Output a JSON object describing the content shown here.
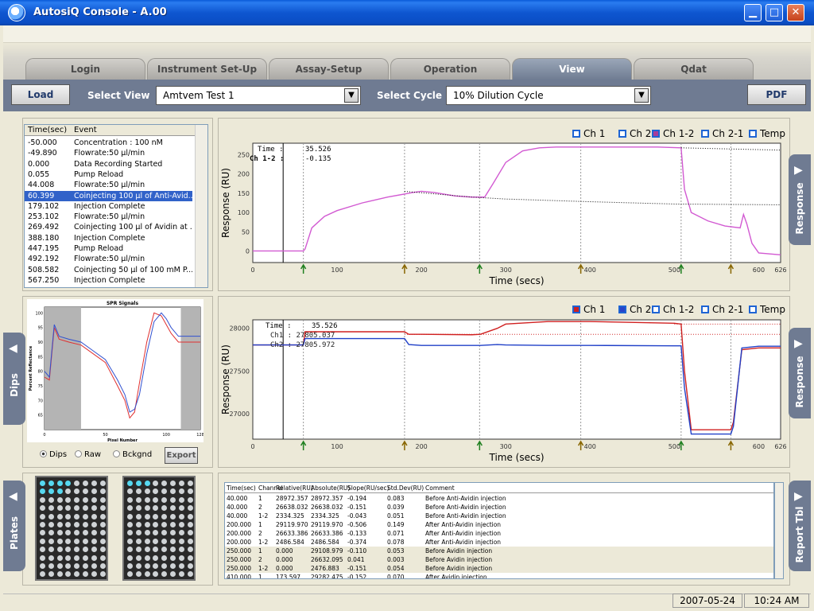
{
  "window": {
    "title": "AutosiQ Console - A.00"
  },
  "tabs": [
    {
      "label": "Login"
    },
    {
      "label": "Instrument Set-Up"
    },
    {
      "label": "Assay-Setup"
    },
    {
      "label": "Operation"
    },
    {
      "label": "View",
      "active": true
    },
    {
      "label": "Qdat"
    }
  ],
  "toolbar": {
    "load_label": "Load",
    "select_view_label": "Select  View",
    "select_view_value": "Amtvem Test 1",
    "select_cycle_label": "Select  Cycle",
    "select_cycle_value": "10% Dilution Cycle",
    "pdf_label": "PDF"
  },
  "events": {
    "headers": [
      "Time(sec)",
      "Event"
    ],
    "rows": [
      [
        "-50.000",
        "Concentration : 100 nM"
      ],
      [
        "-49.890",
        "Flowrate:50 µl/min"
      ],
      [
        "0.000",
        "Data Recording Started"
      ],
      [
        "0.055",
        "Pump Reload"
      ],
      [
        "44.008",
        "Flowrate:50 µl/min"
      ],
      [
        "60.399",
        "Coinjecting 100 µl of Anti-Avid..."
      ],
      [
        "179.102",
        "Injection Complete"
      ],
      [
        "253.102",
        "Flowrate:50 µl/min"
      ],
      [
        "269.492",
        "Coinjecting 100 µl of Avidin at ..."
      ],
      [
        "388.180",
        "Injection Complete"
      ],
      [
        "447.195",
        "Pump Reload"
      ],
      [
        "492.192",
        "Flowrate:50 µl/min"
      ],
      [
        "508.582",
        "Coinjecting 50 µl of 100 mM P..."
      ],
      [
        "567.250",
        "Injection Complete"
      ]
    ],
    "selected_index": 5
  },
  "top_chart": {
    "legend": [
      "Ch 1",
      "Ch 2",
      "Ch 1-2",
      "Ch 2-1",
      "Temp"
    ],
    "cursor_time_label": "Time :",
    "cursor_time_value": "35.526",
    "cursor_ch_label": "Ch 1-2 :",
    "cursor_ch_value": "-0.135",
    "ylabel": "Response (RU)",
    "xlabel": "Time (secs)"
  },
  "bottom_chart": {
    "legend": [
      "Ch 1",
      "Ch 2",
      "Ch 1-2",
      "Ch 2-1",
      "Temp"
    ],
    "cursor_time_label": "Time :",
    "cursor_time_value": "35.526",
    "cursor_ch1": "Ch1 : 27805.037",
    "cursor_ch2": "Ch2 : 27805.972",
    "ylabel": "Response (RU)",
    "xlabel": "Time (secs)"
  },
  "chart_data": [
    {
      "type": "line",
      "title": "",
      "xlabel": "Time (secs)",
      "ylabel": "Response (RU)",
      "xlim": [
        0,
        626
      ],
      "ylim": [
        -30,
        280
      ],
      "xticks": [
        0,
        100,
        200,
        300,
        400,
        500,
        600,
        626
      ],
      "yticks": [
        0,
        50,
        100,
        150,
        200,
        250
      ],
      "series": [
        {
          "name": "Ch 1-2",
          "color": "#d25ad2",
          "x": [
            0,
            60,
            62,
            70,
            85,
            100,
            130,
            160,
            190,
            200,
            215,
            240,
            260,
            275,
            285,
            300,
            320,
            340,
            360,
            400,
            440,
            480,
            508,
            512,
            520,
            540,
            560,
            578,
            582,
            586,
            592,
            600,
            626
          ],
          "y": [
            0,
            0,
            5,
            60,
            90,
            105,
            125,
            140,
            152,
            155,
            152,
            143,
            140,
            140,
            175,
            230,
            260,
            268,
            270,
            270,
            270,
            270,
            268,
            160,
            100,
            78,
            65,
            60,
            95,
            70,
            20,
            -5,
            -10
          ]
        },
        {
          "name": "reference-dotted",
          "color": "#000000",
          "dotted": true,
          "x": [
            180,
            260,
            300,
            400,
            500,
            626
          ],
          "y": [
            155,
            140,
            135,
            128,
            122,
            120
          ]
        },
        {
          "name": "reference-dotted-upper",
          "color": "#000000",
          "dotted": true,
          "x": [
            508,
            626
          ],
          "y": [
            268,
            262
          ]
        }
      ],
      "injection_markers": [
        60,
        180,
        269,
        389,
        508,
        567
      ]
    },
    {
      "type": "line",
      "title": "",
      "xlabel": "Time (secs)",
      "ylabel": "Response (RU)",
      "xlim": [
        0,
        626
      ],
      "ylim": [
        26700,
        28100
      ],
      "xticks": [
        0,
        100,
        200,
        300,
        400,
        500,
        600,
        626
      ],
      "yticks": [
        27000,
        27500,
        28000
      ],
      "series": [
        {
          "name": "Ch 1",
          "color": "#d02020",
          "x": [
            0,
            60,
            62,
            180,
            185,
            200,
            260,
            270,
            290,
            300,
            350,
            400,
            500,
            508,
            512,
            520,
            567,
            570,
            580,
            600,
            626
          ],
          "y": [
            27805,
            27805,
            27960,
            27960,
            27930,
            27930,
            27925,
            27930,
            28000,
            28050,
            28080,
            28080,
            28060,
            28050,
            27500,
            26810,
            26810,
            26900,
            27750,
            27770,
            27770
          ]
        },
        {
          "name": "Ch 2",
          "color": "#2040c8",
          "x": [
            0,
            60,
            62,
            180,
            185,
            200,
            260,
            270,
            290,
            300,
            350,
            400,
            500,
            508,
            512,
            520,
            567,
            570,
            580,
            600,
            626
          ],
          "y": [
            27805,
            27805,
            27880,
            27880,
            27810,
            27800,
            27800,
            27800,
            27810,
            27805,
            27800,
            27800,
            27795,
            27795,
            27300,
            26760,
            26760,
            26850,
            27770,
            27790,
            27790
          ]
        },
        {
          "name": "Ch1-ref",
          "color": "#d02020",
          "dotted": true,
          "x": [
            500,
            626
          ],
          "y": [
            28050,
            28050
          ]
        },
        {
          "name": "Ch1-ref2",
          "color": "#d02020",
          "dotted": true,
          "x": [
            180,
            626
          ],
          "y": [
            27930,
            27930
          ]
        }
      ],
      "injection_markers": [
        60,
        180,
        269,
        389,
        508,
        567
      ]
    },
    {
      "type": "line",
      "title": "SPR Signals",
      "xlabel": "Pixel Number",
      "ylabel": "Percent Reflectance",
      "xlim": [
        0,
        128
      ],
      "ylim": [
        60,
        102
      ],
      "xticks": [
        0,
        50,
        100,
        128
      ],
      "yticks": [
        65,
        70,
        75,
        80,
        85,
        90,
        95,
        100
      ],
      "series": [
        {
          "name": "red",
          "color": "#e03030",
          "x": [
            0,
            4,
            8,
            12,
            20,
            30,
            40,
            50,
            60,
            66,
            70,
            74,
            78,
            84,
            90,
            96,
            100,
            104,
            110,
            116,
            120,
            128
          ],
          "y": [
            78,
            77,
            95,
            91,
            90,
            89,
            86,
            83,
            75,
            70,
            64,
            66,
            76,
            90,
            100,
            99,
            96,
            93,
            90,
            90,
            90,
            90
          ]
        },
        {
          "name": "blue",
          "color": "#3050d0",
          "x": [
            0,
            4,
            8,
            12,
            20,
            30,
            40,
            50,
            60,
            66,
            70,
            74,
            78,
            84,
            90,
            96,
            100,
            104,
            110,
            116,
            120,
            128
          ],
          "y": [
            80,
            78,
            96,
            92,
            91,
            90,
            87,
            84,
            77,
            72,
            66,
            67,
            72,
            86,
            97,
            100,
            98,
            95,
            92,
            92,
            92,
            92
          ]
        }
      ]
    }
  ],
  "dips_panel": {
    "options": [
      "Dips",
      "Raw",
      "Bckgnd"
    ],
    "selected": "Dips",
    "export_label": "Export"
  },
  "side_tabs": {
    "dips": "Dips",
    "plates": "Plates",
    "response1": "Response",
    "response2": "Response",
    "report": "Report Tbl"
  },
  "report": {
    "headers": [
      "Time(sec)",
      "Channel",
      "Relative(RU)",
      "Absolute(RU)",
      "Slope(RU/sec)",
      "Std.Dev(RU)",
      "Comment"
    ],
    "rows": [
      [
        "40.000",
        "1",
        "28972.357",
        "28972.357",
        "-0.194",
        "0.083",
        "Before Anti-Avidin injection"
      ],
      [
        "40.000",
        "2",
        "26638.032",
        "26638.032",
        "-0.151",
        "0.039",
        "Before Anti-Avidin injection"
      ],
      [
        "40.000",
        "1-2",
        "2334.325",
        "2334.325",
        "-0.043",
        "0.051",
        "Before Anti-Avidin injection"
      ],
      [
        "200.000",
        "1",
        "29119.970",
        "29119.970",
        "-0.506",
        "0.149",
        "After Anti-Avidin injection"
      ],
      [
        "200.000",
        "2",
        "26633.386",
        "26633.386",
        "-0.133",
        "0.071",
        "After Anti-Avidin injection"
      ],
      [
        "200.000",
        "1-2",
        "2486.584",
        "2486.584",
        "-0.374",
        "0.078",
        "After Anti-Avidin injection"
      ],
      [
        "250.000",
        "1",
        "0.000",
        "29108.979",
        "-0.110",
        "0.053",
        "Before Avidin injection"
      ],
      [
        "250.000",
        "2",
        "0.000",
        "26632.095",
        "0.041",
        "0.003",
        "Before Avidin injection"
      ],
      [
        "250.000",
        "1-2",
        "0.000",
        "2476.883",
        "-0.151",
        "0.054",
        "Before Avidin injection"
      ],
      [
        "410.000",
        "1",
        "173.597",
        "29282.475",
        "-0.152",
        "0.070",
        "After Avidin injection"
      ]
    ]
  },
  "status": {
    "date": "2007-05-24",
    "time": "10:24 AM"
  }
}
